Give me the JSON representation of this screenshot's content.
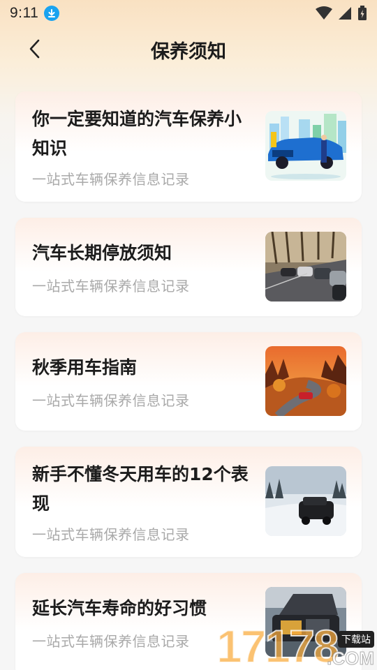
{
  "status_bar": {
    "time": "9:11"
  },
  "header": {
    "title": "保养须知"
  },
  "articles": [
    {
      "title": "你一定要知道的汽车保养小知识",
      "subtitle": "一站式车辆保养信息记录",
      "image": "car-repair-illustration"
    },
    {
      "title": "汽车长期停放须知",
      "subtitle": "一站式车辆保养信息记录",
      "image": "parked-cars-photo"
    },
    {
      "title": "秋季用车指南",
      "subtitle": "一站式车辆保养信息记录",
      "image": "autumn-road-photo"
    },
    {
      "title": "新手不懂冬天用车的12个表现",
      "subtitle": "一站式车辆保养信息记录",
      "image": "winter-suv-photo"
    },
    {
      "title": "延长汽车寿命的好习惯",
      "subtitle": "一站式车辆保养信息记录",
      "image": "engine-bay-photo"
    }
  ],
  "watermark": {
    "digits": "17178",
    "domain": ".COM",
    "tag": "下载站"
  },
  "colors": {
    "accent_download": "#1aa3f0",
    "subtitle_gray": "#a9a9a9"
  }
}
